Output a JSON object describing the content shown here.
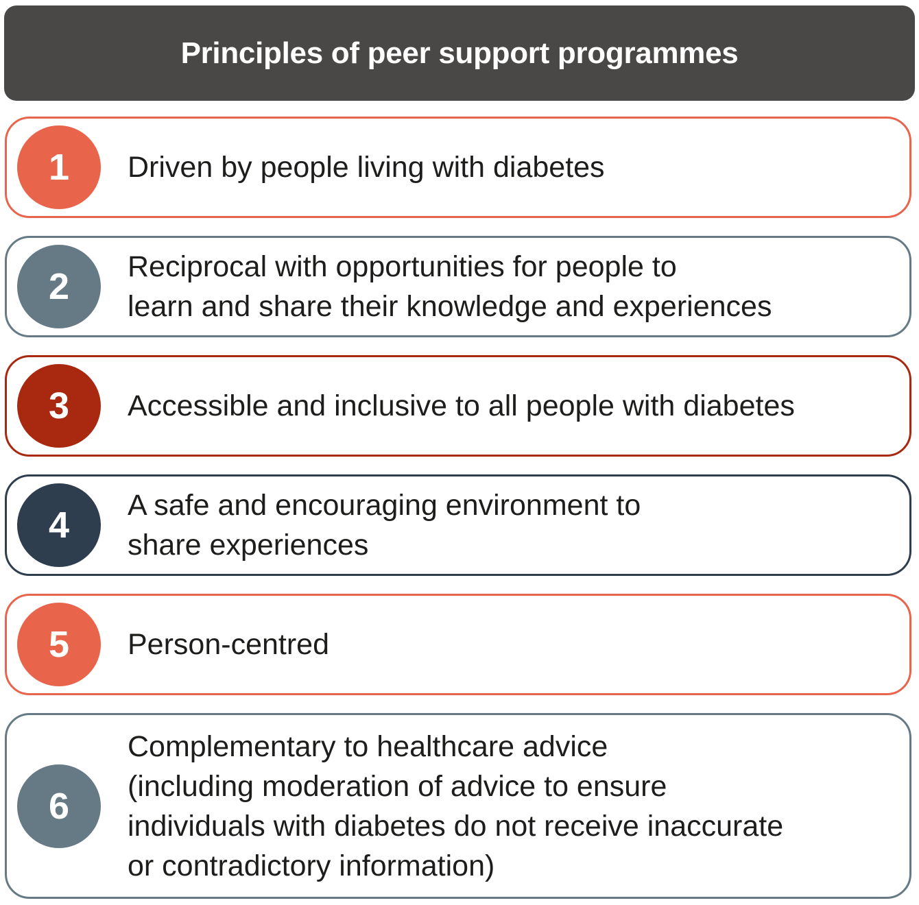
{
  "header": {
    "title": "Principles of peer support programmes"
  },
  "colors": {
    "header_bg": "#4a4846",
    "coral": "#e8644a",
    "slate": "#657a85",
    "dark_red": "#a8290f",
    "navy": "#2f3e4e"
  },
  "principles": [
    {
      "number": "1",
      "text": "Driven by people living with diabetes",
      "color": "#e8644a"
    },
    {
      "number": "2",
      "text": "Reciprocal with opportunities for people to\nlearn and share their knowledge and experiences",
      "color": "#657a85"
    },
    {
      "number": "3",
      "text": "Accessible and inclusive to all people with diabetes",
      "color": "#a8290f"
    },
    {
      "number": "4",
      "text": "A safe and encouraging environment to\nshare experiences",
      "color": "#2f3e4e"
    },
    {
      "number": "5",
      "text": "Person-centred",
      "color": "#e8644a"
    },
    {
      "number": "6",
      "text": "Complementary to healthcare advice\n(including moderation of advice to ensure\nindividuals with diabetes do not receive inaccurate\nor contradictory information)",
      "color": "#657a85"
    }
  ]
}
